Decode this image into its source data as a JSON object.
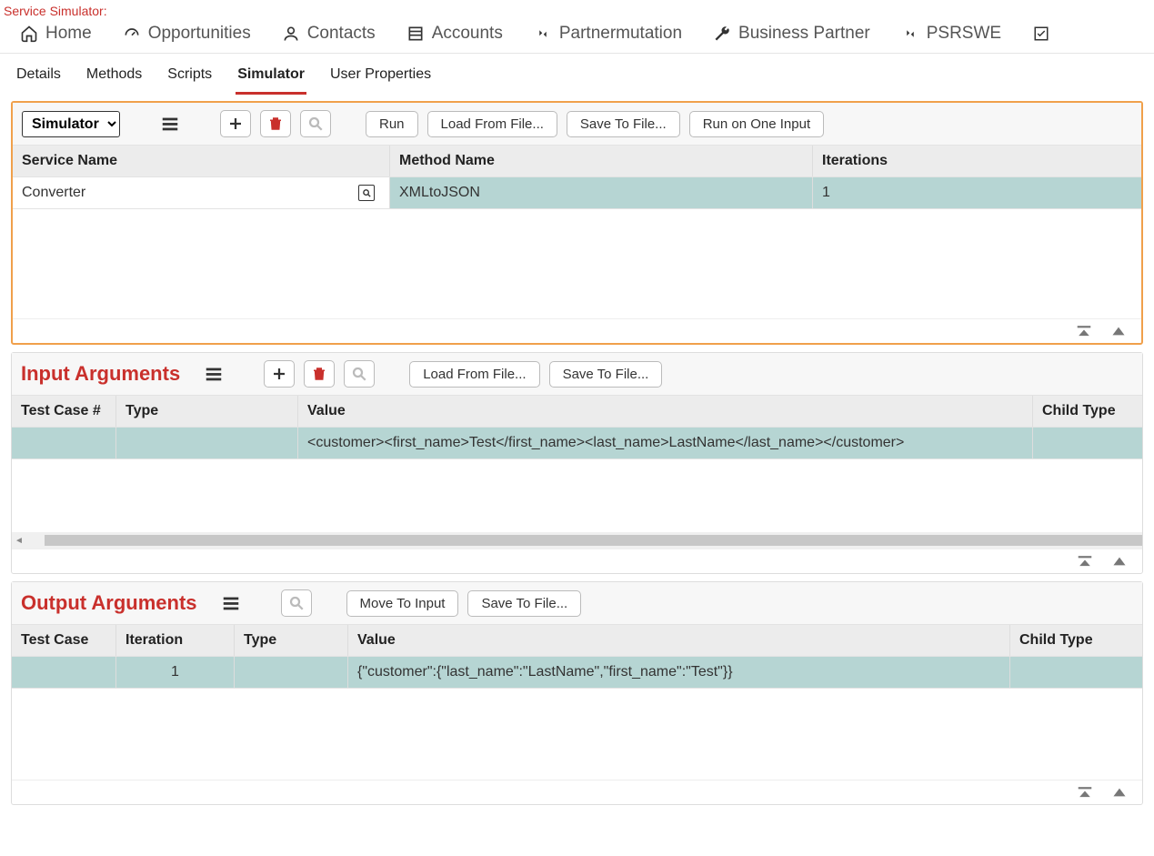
{
  "breadcrumb": "Service Simulator:",
  "topnav": [
    {
      "label": "Home",
      "icon": "home"
    },
    {
      "label": "Opportunities",
      "icon": "gauge"
    },
    {
      "label": "Contacts",
      "icon": "person"
    },
    {
      "label": "Accounts",
      "icon": "list"
    },
    {
      "label": "Partnermutation",
      "icon": "swap"
    },
    {
      "label": "Business Partner",
      "icon": "wrench"
    },
    {
      "label": "PSRSWE",
      "icon": "swap"
    }
  ],
  "tabs": [
    "Details",
    "Methods",
    "Scripts",
    "Simulator",
    "User Properties"
  ],
  "active_tab": "Simulator",
  "simulator": {
    "dropdown": "Simulator",
    "buttons": {
      "run": "Run",
      "load": "Load From File...",
      "save": "Save To File...",
      "run_one": "Run on One Input"
    },
    "columns": {
      "service": "Service Name",
      "method": "Method Name",
      "iterations": "Iterations"
    },
    "row": {
      "service": "Converter",
      "method": "XMLtoJSON",
      "iterations": "1"
    }
  },
  "input": {
    "title": "Input Arguments",
    "buttons": {
      "load": "Load From File...",
      "save": "Save To File..."
    },
    "columns": {
      "testcase": "Test Case #",
      "type": "Type",
      "value": "Value",
      "child": "Child Type"
    },
    "row": {
      "testcase": "",
      "type": "",
      "value": "<customer><first_name>Test</first_name><last_name>LastName</last_name></customer>",
      "child": ""
    }
  },
  "output": {
    "title": "Output Arguments",
    "buttons": {
      "move": "Move To Input",
      "save": "Save To File..."
    },
    "columns": {
      "testcase": "Test Case",
      "iteration": "Iteration",
      "type": "Type",
      "value": "Value",
      "child": "Child Type"
    },
    "row": {
      "testcase": "",
      "iteration": "1",
      "type": "",
      "value": "{\"customer\":{\"last_name\":\"LastName\",\"first_name\":\"Test\"}}",
      "child": ""
    }
  }
}
